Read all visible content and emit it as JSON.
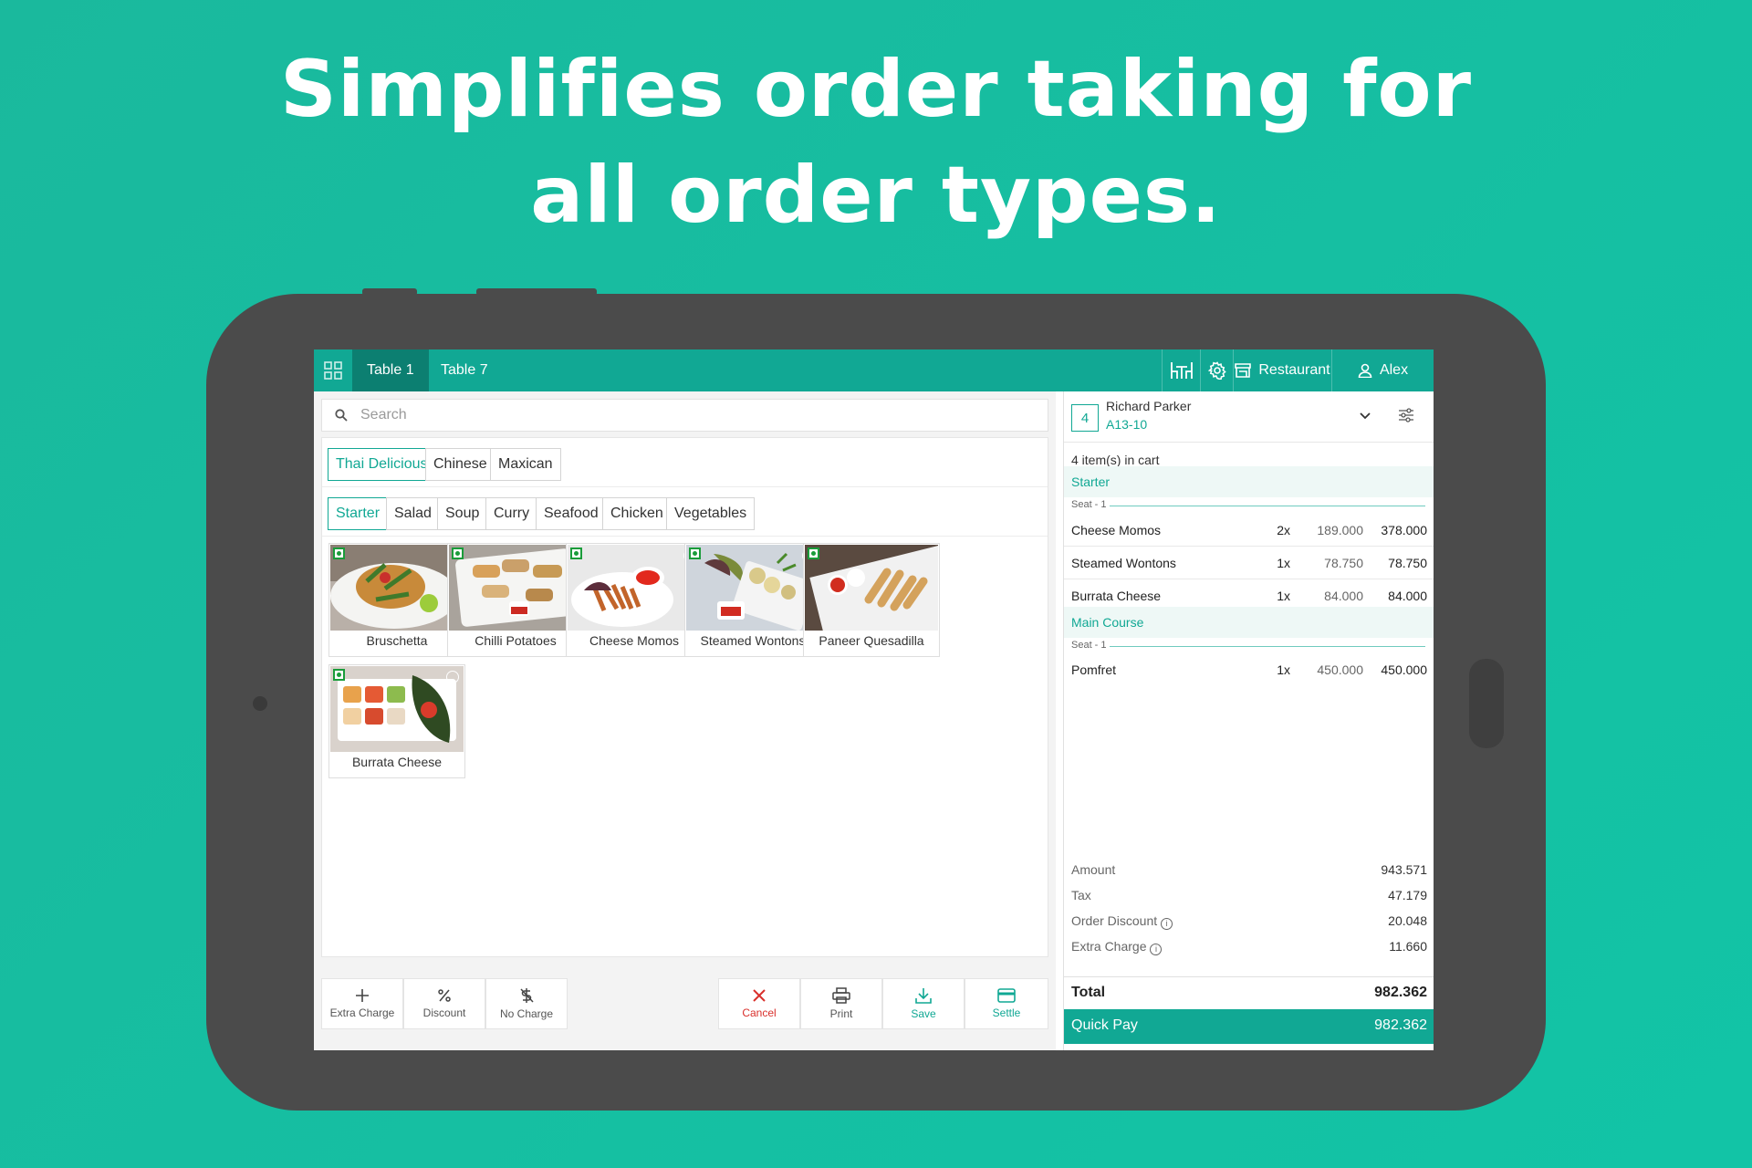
{
  "headline": {
    "line1": "Simplifies order taking for",
    "line2": "all order types."
  },
  "topbar": {
    "tabs": [
      {
        "label": "Table 1",
        "active": true
      },
      {
        "label": "Table 7",
        "active": false
      }
    ],
    "restaurant_label": "Restaurant",
    "user_label": "Alex"
  },
  "search": {
    "placeholder": "Search"
  },
  "cuisines": [
    {
      "label": "Thai Delicious",
      "active": true
    },
    {
      "label": "Chinese",
      "active": false
    },
    {
      "label": "Maxican",
      "active": false
    }
  ],
  "categories": [
    {
      "label": "Starter",
      "active": true
    },
    {
      "label": "Salad"
    },
    {
      "label": "Soup"
    },
    {
      "label": "Curry"
    },
    {
      "label": "Seafood"
    },
    {
      "label": "Chicken"
    },
    {
      "label": "Vegetables"
    }
  ],
  "menu_items": [
    {
      "name": "Bruschetta"
    },
    {
      "name": "Chilli Potatoes"
    },
    {
      "name": "Cheese Momos"
    },
    {
      "name": "Steamed Wontons"
    },
    {
      "name": "Paneer Quesadilla"
    },
    {
      "name": "Burrata Cheese"
    }
  ],
  "bottom_actions": {
    "extra_charge": "Extra Charge",
    "discount": "Discount",
    "no_charge": "No Charge",
    "cancel": "Cancel",
    "print": "Print",
    "save": "Save",
    "settle": "Settle"
  },
  "order": {
    "seat_number": "4",
    "customer_name": "Richard Parker",
    "customer_code": "A13-10",
    "cart_count": "4 item(s) in cart",
    "sections": [
      {
        "title": "Starter",
        "seat": "Seat - 1",
        "items": [
          {
            "name": "Cheese Momos",
            "qty": "2x",
            "price": "189.000",
            "total": "378.000"
          },
          {
            "name": "Steamed Wontons",
            "qty": "1x",
            "price": "78.750",
            "total": "78.750"
          },
          {
            "name": "Burrata Cheese",
            "qty": "1x",
            "price": "84.000",
            "total": "84.000"
          }
        ]
      },
      {
        "title": "Main Course",
        "seat": "Seat - 1",
        "items": [
          {
            "name": "Pomfret",
            "qty": "1x",
            "price": "450.000",
            "total": "450.000"
          }
        ]
      }
    ],
    "summary": {
      "amount_label": "Amount",
      "amount": "943.571",
      "tax_label": "Tax",
      "tax": "47.179",
      "discount_label": "Order Discount",
      "discount": "20.048",
      "extra_label": "Extra Charge",
      "extra": "11.660"
    },
    "total_label": "Total",
    "total": "982.362",
    "quick_pay_label": "Quick Pay",
    "quick_pay_amount": "982.362"
  },
  "colors": {
    "accent": "#11a894",
    "accent_dark": "#0c7f71",
    "cancel": "#d9302c",
    "background": "#12c4a6"
  }
}
